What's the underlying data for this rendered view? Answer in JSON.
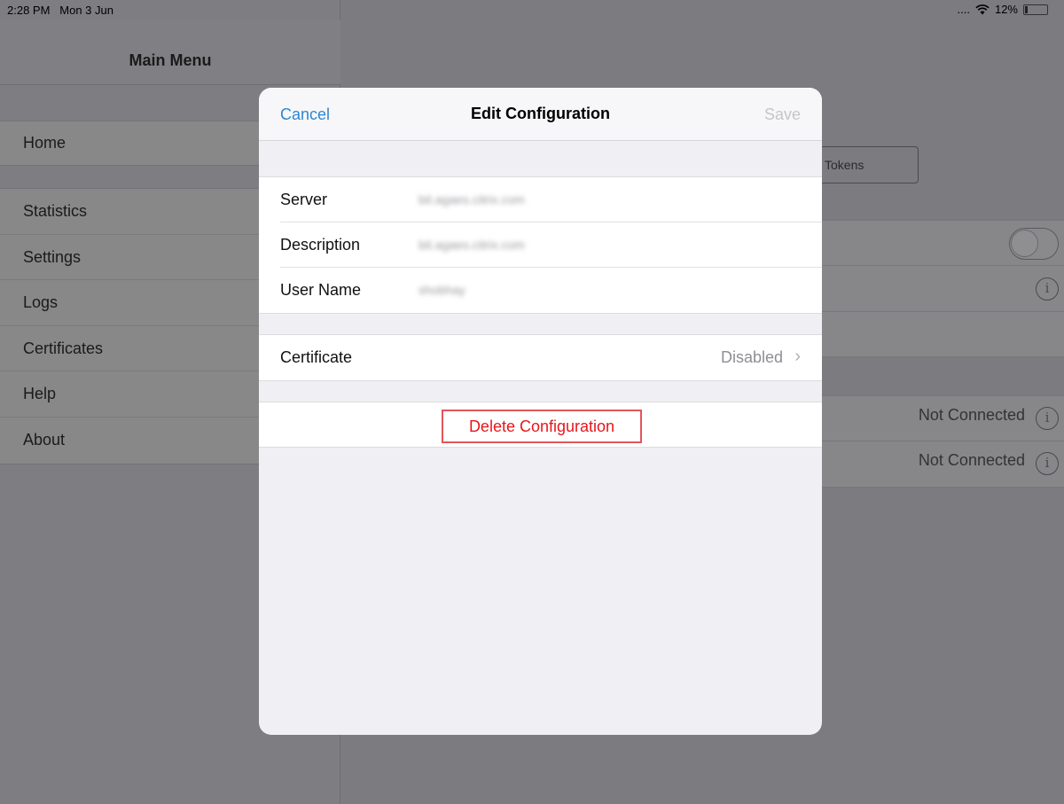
{
  "status_bar": {
    "time": "2:28 PM",
    "date": "Mon 3 Jun",
    "signal": "....",
    "wifi_icon": "wifi-icon",
    "battery_percent": "12%",
    "battery_level": 0.12
  },
  "sidebar": {
    "title": "Main Menu",
    "home": "Home",
    "items": [
      {
        "label": "Statistics"
      },
      {
        "label": "Settings"
      },
      {
        "label": "Logs"
      },
      {
        "label": "Certificates"
      },
      {
        "label": "Help"
      },
      {
        "label": "About"
      }
    ]
  },
  "background": {
    "tokens_button": "Tokens",
    "rows": [
      {
        "status": "Not Connected"
      },
      {
        "status": "Not Connected"
      }
    ]
  },
  "modal": {
    "cancel": "Cancel",
    "title": "Edit Configuration",
    "save": "Save",
    "fields": [
      {
        "label": "Server",
        "value": "bit.agaes.citrix.com"
      },
      {
        "label": "Description",
        "value": "bit.agaes.citrix.com"
      },
      {
        "label": "User Name",
        "value": "shobhay"
      }
    ],
    "certificate": {
      "label": "Certificate",
      "value": "Disabled"
    },
    "delete_button": "Delete Configuration"
  },
  "colors": {
    "accent": "#2f86d2",
    "destructive": "#e8161a",
    "highlight_box": "#e2555a"
  }
}
